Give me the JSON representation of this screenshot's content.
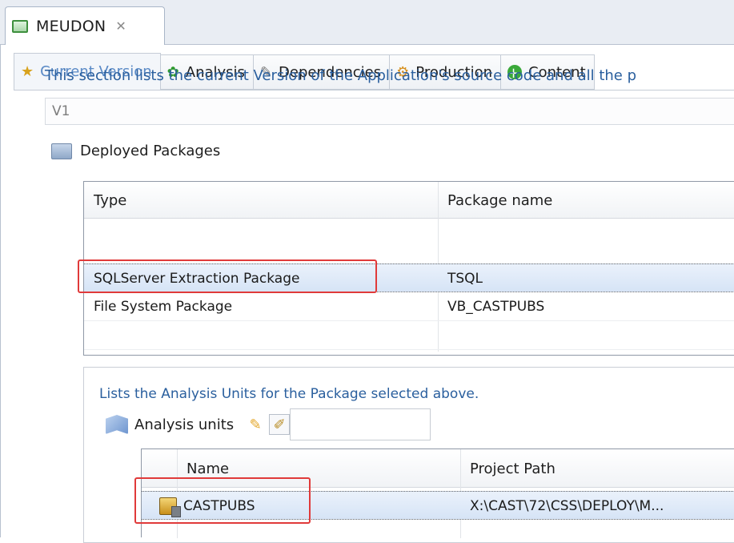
{
  "editor_tab": {
    "label": "MEUDON",
    "close_glyph": "✕",
    "icon": "app-icon"
  },
  "subtabs": [
    {
      "label": "Current Version",
      "icon": "version-icon",
      "active": true
    },
    {
      "label": "Analysis",
      "icon": "analysis-icon",
      "active": false
    },
    {
      "label": "Dependencies",
      "icon": "dependencies-icon",
      "active": false
    },
    {
      "label": "Production",
      "icon": "production-icon",
      "active": false
    },
    {
      "label": "Content",
      "icon": "content-icon",
      "active": false
    }
  ],
  "description": "This section lists the current Version of the Application's source code and all the p",
  "version_value": "V1",
  "deployed_packages": {
    "title": "Deployed Packages",
    "columns": [
      "Type",
      "Package name"
    ],
    "rows": [
      {
        "type": "SQLServer Extraction Package",
        "name": "TSQL",
        "selected": true
      },
      {
        "type": "File System Package",
        "name": "VB_CASTPUBS",
        "selected": false
      }
    ]
  },
  "analysis_units": {
    "description": "Lists the Analysis Units for the Package selected above.",
    "label": "Analysis units",
    "columns": [
      "Name",
      "Project Path"
    ],
    "rows": [
      {
        "name": "CASTPUBS",
        "path": "X:\\CAST\\72\\CSS\\DEPLOY\\M..."
      }
    ]
  },
  "colors": {
    "accent": "#5a8ac6",
    "link_text": "#2a5f9e",
    "highlight_box": "#e03a3a"
  }
}
